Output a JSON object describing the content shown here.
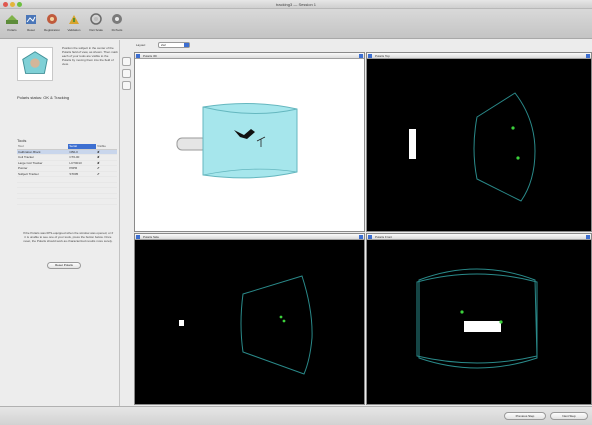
{
  "window": {
    "title": "tracking3 — Session 1"
  },
  "toolbar": {
    "items": [
      {
        "label": "Polaris",
        "icon": "polaris-icon"
      },
      {
        "label": "Reset",
        "icon": "reset-icon"
      },
      {
        "label": "Registration",
        "icon": "registration-icon"
      },
      {
        "label": "Validation",
        "icon": "validation-icon"
      },
      {
        "label": "Visit Scale",
        "icon": "visit-scale-icon"
      },
      {
        "label": "RoTools",
        "icon": "rotools-icon"
      }
    ]
  },
  "left_panel": {
    "instructions": "Position the subject in the center of the Polaris field of view, as shown. Then mark each of your tools are visible to the Polaris by moving them into the field of view.",
    "status_label": "Polaris status:",
    "status_value": "OK & Tracking",
    "tools_heading": "Tools",
    "tool_columns": [
      "Tool",
      "Serial",
      "Visible"
    ],
    "tools": [
      {
        "name": "Calibration Block",
        "serial": "CB0-0",
        "visible": false
      },
      {
        "name": "Coil Tracker",
        "serial": "CT0-00",
        "visible": false
      },
      {
        "name": "Large Coil Tracker",
        "serial": "LCT0013",
        "visible": false
      },
      {
        "name": "Pointer",
        "serial": "P0PR",
        "visible": true
      },
      {
        "name": "Subject Tracker",
        "serial": "ST005",
        "visible": true
      }
    ],
    "bottom_note": "If the Polaris was 0PS-equipped when the window was opened, or if it is unable to see one of your tools, press the button below. Once reset, the Polaris should work as characterized results more surely.",
    "reset_button": "Reset Polaris"
  },
  "layout": {
    "label": "Layout:",
    "value": "2x2"
  },
  "views": {
    "view3d": "Polaris 3D",
    "top": "Polaris Top",
    "side": "Polaris Side",
    "front": "Polaris Front"
  },
  "nav": {
    "previous": "Previous Step",
    "next": "Next Step"
  },
  "colors": {
    "accent": "#3d6fd1",
    "frustum_line": "#2a8a8a",
    "frustum_fill": "#9fe3ea",
    "tool_dot": "#3cd13c",
    "status_ok": "#27a83a",
    "status_bad": "#d23a2b"
  }
}
